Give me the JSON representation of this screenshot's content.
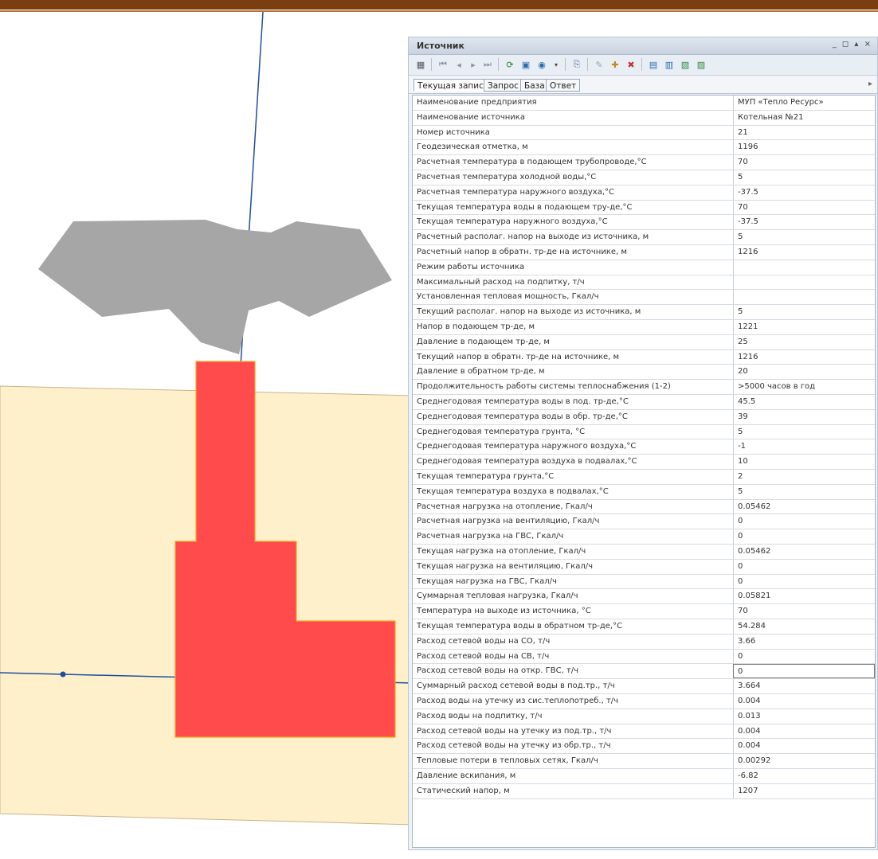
{
  "colors": {
    "header_bar": "#7a3e10",
    "building_fill": "#ff4b4b",
    "building_outline": "#f5a623",
    "zone_fill": "#fff0cc",
    "cloud_fill": "#a6a6a6",
    "pipe_line": "#1f4e9b"
  },
  "map": {
    "layers": [
      "pipe-lines",
      "grey-polygon",
      "zone-polygon",
      "boiler-building",
      "pipe-node"
    ]
  },
  "panel": {
    "title": "Источник",
    "window_controls": "_ ◻ ▴ ×",
    "toolbar_icons": [
      "grid-icon",
      "first-record-icon",
      "prev-record-icon",
      "next-record-icon",
      "last-record-icon",
      "refresh-icon",
      "table-icon",
      "globe-icon",
      "dropdown-arrow-icon",
      "export-icon",
      "edit-icon",
      "add-icon",
      "delete-icon",
      "calc-icon",
      "calc2-icon",
      "report-icon",
      "settings-icon"
    ],
    "tabs": [
      "Текущая запись",
      "Запрос",
      "База",
      "Ответ"
    ],
    "tab_scroll": "▸",
    "rows": [
      {
        "name": "Наименование предприятия",
        "value": "МУП «Тепло Ресурс»"
      },
      {
        "name": "Наименование источника",
        "value": "Котельная №21"
      },
      {
        "name": "Номер источника",
        "value": "21"
      },
      {
        "name": "Геодезическая отметка, м",
        "value": "1196"
      },
      {
        "name": "Расчетная температура в подающем трубопроводе,°С",
        "value": "70"
      },
      {
        "name": "Расчетная температура холодной воды,°С",
        "value": "5"
      },
      {
        "name": "Расчетная температура наружного воздуха,°С",
        "value": "-37.5"
      },
      {
        "name": "Текущая температура воды в подающем тру-де,°С",
        "value": "70"
      },
      {
        "name": "Текущая температура  наружного воздуха,°С",
        "value": "-37.5"
      },
      {
        "name": "Расчетный располаг. напор на выходе из источника, м",
        "value": "5"
      },
      {
        "name": "Расчетный напор в обратн. тр-де на источнике, м",
        "value": "1216"
      },
      {
        "name": "Режим работы источника",
        "value": ""
      },
      {
        "name": "Максимальный расход на подпитку, т/ч",
        "value": ""
      },
      {
        "name": "Установленная тепловая мощность, Гкал/ч",
        "value": ""
      },
      {
        "name": "Текущий располаг. напор на выходе из источника, м",
        "value": "5"
      },
      {
        "name": "Напор в подающем тр-де, м",
        "value": "1221"
      },
      {
        "name": "Давление в подающем тр-де, м",
        "value": "25"
      },
      {
        "name": "Текущий напор в обратн. тр-де на источнике, м",
        "value": "1216"
      },
      {
        "name": "Давление в обратном тр-де, м",
        "value": "20"
      },
      {
        "name": "Продолжительность работы системы теплоснабжения (1-2)",
        "value": ">5000 часов в год"
      },
      {
        "name": "Среднегодовая температура воды в под. тр-де,°С",
        "value": "45.5"
      },
      {
        "name": "Среднегодовая температура воды в обр. тр-де,°С",
        "value": "39"
      },
      {
        "name": "Среднегодовая температура грунта, °С",
        "value": "5"
      },
      {
        "name": "Среднегодовая температура наружного воздуха,°С",
        "value": "-1"
      },
      {
        "name": "Среднегодовая температура воздуха в подвалах,°С",
        "value": "10"
      },
      {
        "name": "Текущая температура грунта,°С",
        "value": "2"
      },
      {
        "name": "Текущая температура воздуха в подвалах,°С",
        "value": "5"
      },
      {
        "name": "Расчетная нагрузка на отопление, Гкал/ч",
        "value": "0.05462"
      },
      {
        "name": "Расчетная нагрузка на вентиляцию, Гкал/ч",
        "value": "0"
      },
      {
        "name": "Расчетная нагрузка на ГВС, Гкал/ч",
        "value": "0"
      },
      {
        "name": "Текущая нагрузка на отопление, Гкал/ч",
        "value": "0.05462"
      },
      {
        "name": "Текущая нагрузка на вентиляцию, Гкал/ч",
        "value": "0"
      },
      {
        "name": "Текущая нагрузка на ГВС, Гкал/ч",
        "value": "0"
      },
      {
        "name": "Суммарная тепловая нагрузка, Гкал/ч",
        "value": "0.05821"
      },
      {
        "name": "Температура на выходе из источника, °С",
        "value": "70"
      },
      {
        "name": "Текущая температура воды в обратном тр-де,°С",
        "value": "54.284"
      },
      {
        "name": "Расход сетевой воды на СО, т/ч",
        "value": "3.66"
      },
      {
        "name": "Расход сетевой воды на СВ, т/ч",
        "value": "0"
      },
      {
        "name": "Расход сетевой воды на откр. ГВС, т/ч",
        "value": "0"
      },
      {
        "name": "Суммарный расход сетевой воды в под.тр., т/ч",
        "value": "3.664"
      },
      {
        "name": "Расход воды на утечку из сис.теплопотреб., т/ч",
        "value": "0.004"
      },
      {
        "name": "Расход воды на подпитку, т/ч",
        "value": "0.013"
      },
      {
        "name": "Расход сетевой воды на утечку из под.тр., т/ч",
        "value": "0.004"
      },
      {
        "name": "Расход сетевой воды на утечку из обр.тр., т/ч",
        "value": "0.004"
      },
      {
        "name": "Тепловые потери в тепловых сетях, Гкал/ч",
        "value": "0.00292"
      },
      {
        "name": "Давление вскипания, м",
        "value": "-6.82"
      },
      {
        "name": "Статический напор, м",
        "value": "1207"
      }
    ],
    "selected_row": 38
  }
}
